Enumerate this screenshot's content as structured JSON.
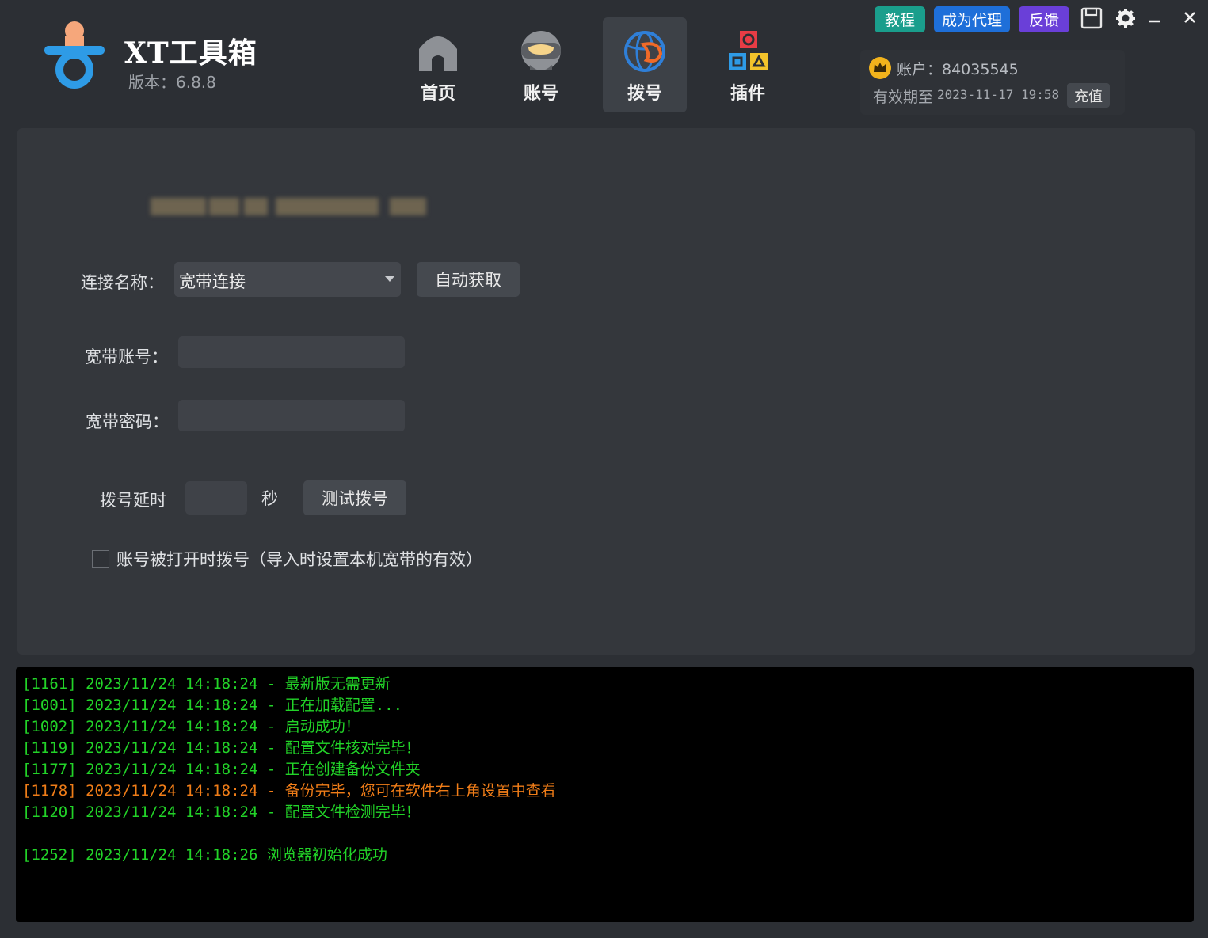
{
  "header": {
    "title": "XT工具箱",
    "version": "版本：6.8.8"
  },
  "nav": {
    "tabs": [
      {
        "label": "首页",
        "icon": "home-icon"
      },
      {
        "label": "账号",
        "icon": "ninja-icon"
      },
      {
        "label": "拨号",
        "icon": "globe-dial-icon",
        "active": true
      },
      {
        "label": "插件",
        "icon": "plugin-shapes-icon"
      }
    ]
  },
  "top_buttons": {
    "tutorial": "教程",
    "agent": "成为代理",
    "feedback": "反馈"
  },
  "colors": {
    "tutorial_bg": "#1a9e8c",
    "agent_bg": "#1e6fd9",
    "feedback_bg": "#6a3fd8",
    "log_green": "#22d328",
    "log_orange": "#f07d18"
  },
  "account": {
    "label": "账户：84035545",
    "expire_label": "有效期至",
    "expire_value": "2023-11-17 19:58",
    "recharge": "充值"
  },
  "form": {
    "connection_label": "连接名称：",
    "connection_value": "宽带连接",
    "auto_fetch": "自动获取",
    "account_label": "宽带账号：",
    "account_value": "",
    "password_label": "宽带密码：",
    "password_value": "",
    "delay_label": "拨号延时",
    "delay_value": "",
    "delay_unit": "秒",
    "test_dial": "测试拨号",
    "checkbox_label": "账号被打开时拨号（导入时设置本机宽带的有效）",
    "checkbox_checked": false
  },
  "log": {
    "lines": [
      {
        "text": "[1161] 2023/11/24 14:18:24 - 最新版无需更新",
        "color": "green"
      },
      {
        "text": "[1001] 2023/11/24 14:18:24 - 正在加载配置...",
        "color": "green"
      },
      {
        "text": "[1002] 2023/11/24 14:18:24 - 启动成功！",
        "color": "green"
      },
      {
        "text": "[1119] 2023/11/24 14:18:24 - 配置文件核对完毕！",
        "color": "green"
      },
      {
        "text": "[1177] 2023/11/24 14:18:24 - 正在创建备份文件夹",
        "color": "green"
      },
      {
        "text": "[1178] 2023/11/24 14:18:24 - 备份完毕，您可在软件右上角设置中查看",
        "color": "orange"
      },
      {
        "text": "[1120] 2023/11/24 14:18:24 - 配置文件检测完毕！",
        "color": "green"
      },
      {
        "text": "",
        "color": "green"
      },
      {
        "text": "[1252] 2023/11/24 14:18:26 浏览器初始化成功",
        "color": "green"
      }
    ]
  }
}
